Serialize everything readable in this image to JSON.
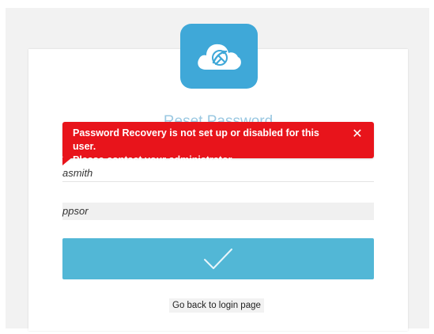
{
  "page": {
    "title": "Reset Password"
  },
  "alert": {
    "line1": "Password Recovery is not set up or disabled for this user.",
    "line2": "Please contact your administrator.",
    "close_glyph": "✕",
    "color": "#e8141b"
  },
  "form": {
    "username_value": "asmith",
    "code_value": "ppsor",
    "submit_icon": "checkmark-icon",
    "submit_color": "#52b7d6"
  },
  "links": {
    "back_label": "Go back to login page"
  },
  "logo": {
    "icon": "cloud-logo-icon",
    "color": "#3fa8d8"
  }
}
